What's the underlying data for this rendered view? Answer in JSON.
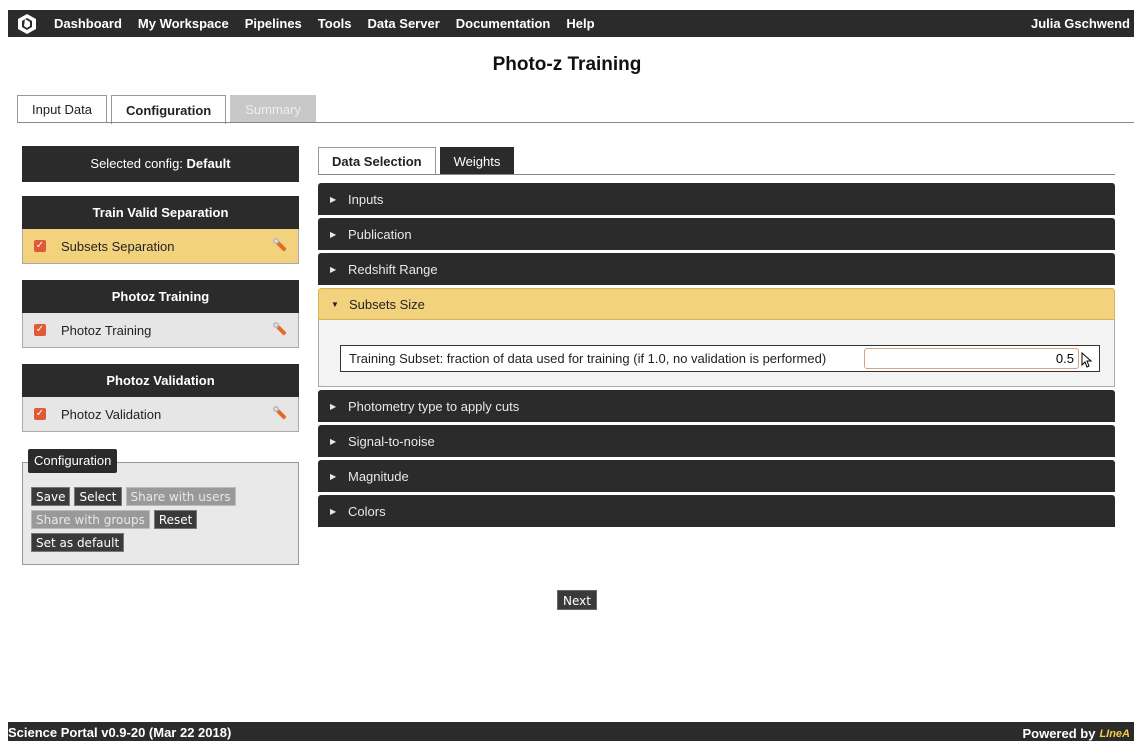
{
  "nav": {
    "items": [
      "Dashboard",
      "My Workspace",
      "Pipelines",
      "Tools",
      "Data Server",
      "Documentation",
      "Help"
    ],
    "user": "Julia Gschwend"
  },
  "page_title": "Photo-z Training",
  "main_tabs": [
    {
      "label": "Input Data",
      "state": "normal"
    },
    {
      "label": "Configuration",
      "state": "active"
    },
    {
      "label": "Summary",
      "state": "disabled"
    }
  ],
  "sidebar": {
    "selected_config_prefix": "Selected config: ",
    "selected_config_value": "Default",
    "sections": [
      {
        "title": "Train Valid Separation",
        "item": "Subsets Separation",
        "active": true
      },
      {
        "title": "Photoz Training",
        "item": "Photoz Training",
        "active": false
      },
      {
        "title": "Photoz Validation",
        "item": "Photoz Validation",
        "active": false
      }
    ],
    "config_box": {
      "label": "Configuration",
      "buttons": [
        {
          "label": "Save",
          "disabled": false
        },
        {
          "label": "Select",
          "disabled": false
        },
        {
          "label": "Share with users",
          "disabled": true
        },
        {
          "label": "Share with groups",
          "disabled": true
        },
        {
          "label": "Reset",
          "disabled": false
        },
        {
          "label": "Set as default",
          "disabled": false
        }
      ]
    }
  },
  "sub_tabs": [
    "Data Selection",
    "Weights"
  ],
  "accordion": [
    {
      "label": "Inputs",
      "open": false
    },
    {
      "label": "Publication",
      "open": false
    },
    {
      "label": "Redshift Range",
      "open": false
    },
    {
      "label": "Subsets Size",
      "open": true
    },
    {
      "label": "Photometry type to apply cuts",
      "open": false
    },
    {
      "label": "Signal-to-noise",
      "open": false
    },
    {
      "label": "Magnitude",
      "open": false
    },
    {
      "label": "Colors",
      "open": false
    }
  ],
  "subsets_field": {
    "label": "Training Subset: fraction of data used for training (if 1.0, no validation is performed)",
    "value": "0.5"
  },
  "next_label": "Next",
  "footer": {
    "left": "Science Portal v0.9-20 (Mar 22 2018)",
    "right": "Powered by",
    "logo_text": "LIneA"
  },
  "colors": {
    "dark": "#2b2b2b",
    "highlight": "#f2d27c",
    "check": "#e05a35"
  }
}
